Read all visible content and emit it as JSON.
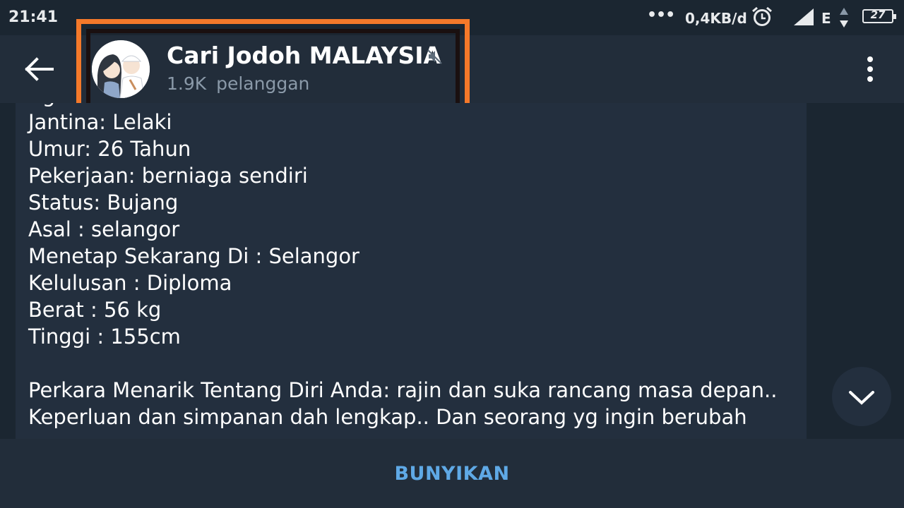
{
  "status_bar": {
    "time": "21:41",
    "dots": "•••",
    "speed": "0,4KB/d",
    "network_type": "E",
    "battery": "27"
  },
  "header": {
    "channel_title": "Cari Jodoh MALAYSIA",
    "subscribers": "1.9K pelanggan",
    "highlight_color": "#f5792a",
    "icons": [
      "back-arrow-icon",
      "mute-icon",
      "more-vert-icon"
    ]
  },
  "message": {
    "partial_top_line": "Agama: Islam",
    "lines": [
      "Jantina: Lelaki",
      "Umur: 26 Tahun",
      "Pekerjaan: berniaga sendiri",
      "Status: Bujang",
      "Asal : selangor",
      "Menetap Sekarang Di : Selangor",
      "Kelulusan : Diploma",
      "Berat : 56 kg",
      "Tinggi : 155cm"
    ],
    "paragraph_lines": [
      "Perkara Menarik Tentang Diri Anda: rajin dan suka rancang masa depan..",
      "Keperluan dan simpanan dah lengkap.. Dan seorang yg ingin berubah"
    ]
  },
  "bottom_bar": {
    "unmute_label": "BUNYIKAN",
    "accent_color": "#5fa9e6"
  },
  "colors": {
    "background": "#1b2631",
    "bar": "#222d3a",
    "bubble": "#232f3e",
    "subtitle": "#8a99a8"
  }
}
